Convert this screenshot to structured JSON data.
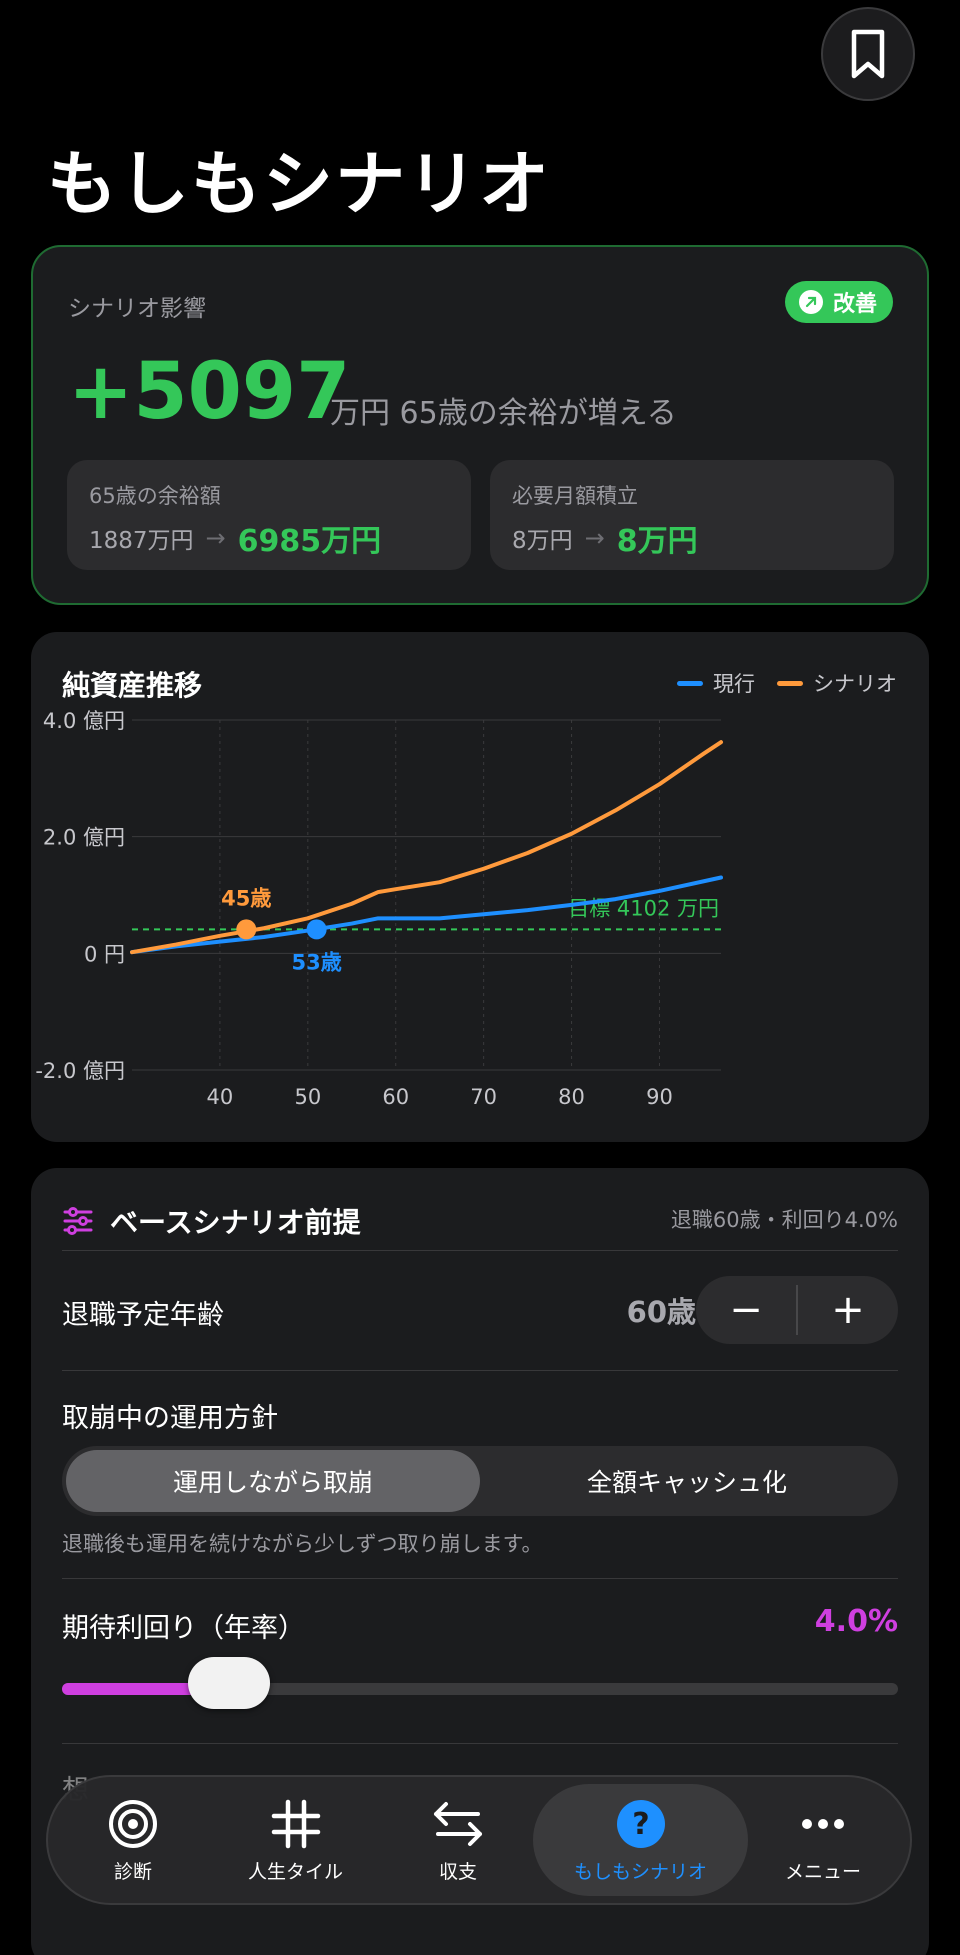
{
  "page": {
    "title": "もしもシナリオ"
  },
  "impact": {
    "label": "シナリオ影響",
    "badge": "改善",
    "value": "+5097",
    "unit_text": "万円 65歳の余裕が増える",
    "stats": [
      {
        "title": "65歳の余裕額",
        "from": "1887万円",
        "to": "6985万円"
      },
      {
        "title": "必要月額積立",
        "from": "8万円",
        "to": "8万円"
      }
    ]
  },
  "chart": {
    "title": "純資産推移",
    "legend": [
      {
        "name": "現行",
        "color": "#1e8fff"
      },
      {
        "name": "シナリオ",
        "color": "#ff9a3c"
      }
    ],
    "target_label": "目標 4102 万円",
    "markers": [
      {
        "label": "45歳",
        "series": "シナリオ"
      },
      {
        "label": "53歳",
        "series": "現行"
      }
    ]
  },
  "chart_data": {
    "type": "line",
    "title": "純資産推移",
    "xlabel": "",
    "ylabel": "",
    "xlim": [
      30,
      97
    ],
    "ylim": [
      -2.0,
      4.0
    ],
    "x_ticks": [
      40,
      50,
      60,
      70,
      80,
      90
    ],
    "x_tick_labels": [
      "40",
      "50",
      "60",
      "70",
      "80",
      "90"
    ],
    "y_ticks": [
      4.0,
      2.0,
      0,
      -2.0
    ],
    "y_tick_labels": [
      "4.0 億円",
      "2.0 億円",
      "0 円",
      "-2.0 億円"
    ],
    "grid": true,
    "legend_position": "top-right",
    "target": {
      "value": 0.41,
      "label": "目標 4102 万円",
      "color": "#34c759"
    },
    "series": [
      {
        "name": "現行",
        "color": "#1e8fff",
        "x": [
          30,
          35,
          40,
          45,
          50,
          55,
          58,
          60,
          65,
          70,
          75,
          80,
          85,
          90,
          97
        ],
        "y": [
          0.02,
          0.12,
          0.2,
          0.28,
          0.39,
          0.51,
          0.6,
          0.6,
          0.6,
          0.67,
          0.74,
          0.83,
          0.93,
          1.07,
          1.3
        ]
      },
      {
        "name": "シナリオ",
        "color": "#ff9a3c",
        "x": [
          30,
          35,
          40,
          45,
          50,
          55,
          58,
          60,
          65,
          70,
          75,
          80,
          85,
          90,
          95,
          97
        ],
        "y": [
          0.02,
          0.15,
          0.3,
          0.43,
          0.6,
          0.85,
          1.05,
          1.1,
          1.22,
          1.45,
          1.72,
          2.05,
          2.45,
          2.9,
          3.42,
          3.62
        ]
      }
    ],
    "markers": [
      {
        "series": "シナリオ",
        "x": 43,
        "y": 0.41,
        "label": "45歳"
      },
      {
        "series": "現行",
        "x": 51,
        "y": 0.41,
        "label": "53歳"
      }
    ]
  },
  "scenario": {
    "title": "ベースシナリオ前提",
    "summary": "退職60歳・利回り4.0%",
    "retire": {
      "label": "退職予定年齢",
      "value": "60歳",
      "minus": "−",
      "plus": "+"
    },
    "policy": {
      "label": "取崩中の運用方針",
      "options": [
        "運用しながら取崩",
        "全額キャッシュ化"
      ],
      "selected": 0,
      "help": "退職後も運用を続けながら少しずつ取り崩します。"
    },
    "rate": {
      "label": "期待利回り（年率）",
      "value": "4.0%",
      "fraction": 0.2
    },
    "next_label": "想"
  },
  "tabs": [
    {
      "label": "診断",
      "icon": "target-icon",
      "active": false
    },
    {
      "label": "人生タイル",
      "icon": "hash-icon",
      "active": false
    },
    {
      "label": "収支",
      "icon": "arrows-swap-icon",
      "active": false
    },
    {
      "label": "もしもシナリオ",
      "icon": "question-circle-icon",
      "active": true
    },
    {
      "label": "メニュー",
      "icon": "more-dots-icon",
      "active": false
    }
  ]
}
